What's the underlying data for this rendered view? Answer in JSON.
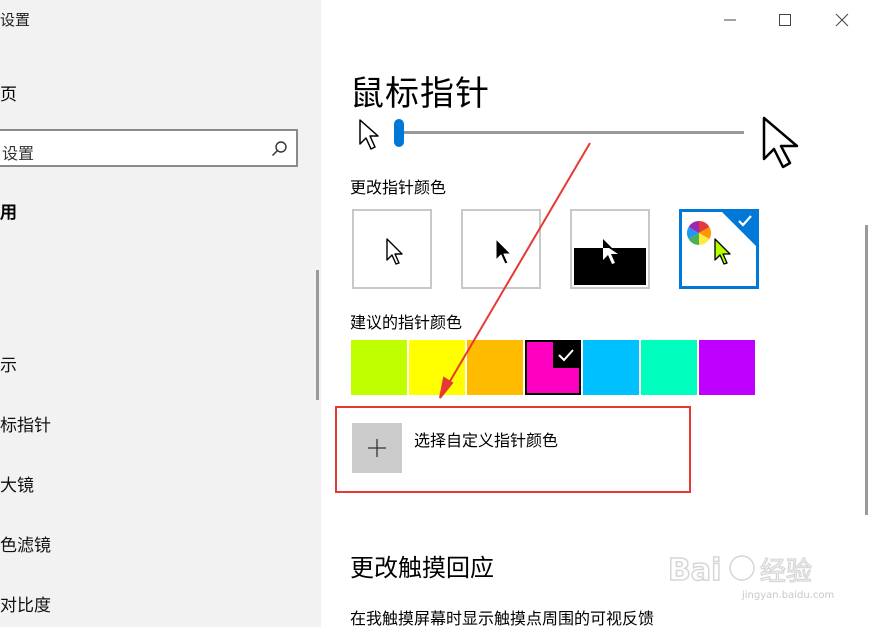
{
  "sidebar": {
    "title": "设置",
    "home": "页",
    "search_text": "设置",
    "section": "用",
    "items": [
      "示",
      "标指针",
      "大镜",
      "色滤镜",
      "对比度"
    ]
  },
  "window": {
    "minimize": "—",
    "maximize": "☐",
    "close": "✕"
  },
  "main": {
    "title": "鼠标指针",
    "change_color_label": "更改指针颜色",
    "suggested_label": "建议的指针颜色",
    "custom_label": "选择自定义指针颜色",
    "touch_heading": "更改触摸回应",
    "touch_desc": "在我触摸屏幕时显示触摸点周围的可视反馈"
  },
  "pointer_styles": [
    {
      "name": "white",
      "selected": false
    },
    {
      "name": "black",
      "selected": false
    },
    {
      "name": "inverted",
      "selected": false
    },
    {
      "name": "custom",
      "selected": true
    }
  ],
  "suggested_colors": [
    "#bfff00",
    "#ffff00",
    "#ffbb00",
    "#ff00c0",
    "#00c0ff",
    "#00ffbf",
    "#bf00ff"
  ],
  "selected_color_index": 3,
  "slider": {
    "value_fraction": 0.0
  },
  "colors": {
    "accent": "#0078d7",
    "highlight_box": "#e53935"
  },
  "watermark": {
    "brand": "Bai 经验",
    "url": "jingyan.baidu.com"
  }
}
